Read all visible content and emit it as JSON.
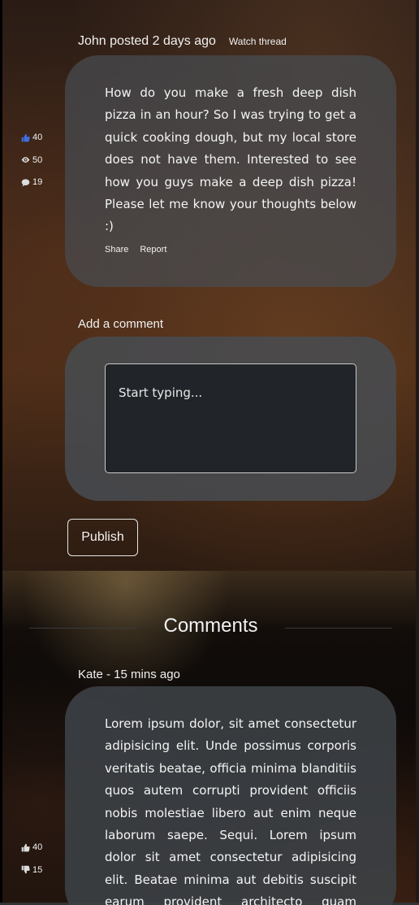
{
  "post": {
    "author_line": "John posted 2 days ago",
    "watch_label": "Watch thread",
    "body": "How do you make a fresh deep dish pizza in an hour? So I was trying to get a quick cooking dough, but my local store does not have them. Interested to see how you guys make a deep dish pizza! Please let me know your thoughts below :)",
    "share_label": "Share",
    "report_label": "Report",
    "stats": {
      "likes": "40",
      "views": "50",
      "comments": "19"
    }
  },
  "compose": {
    "label": "Add a comment",
    "placeholder": "Start typing...",
    "publish_label": "Publish"
  },
  "comments_section": {
    "title": "Comments",
    "items": [
      {
        "meta": "Kate - 15 mins ago",
        "body": "Lorem ipsum dolor, sit amet consectetur adipisicing elit. Unde possimus corporis veritatis beatae, officia minima blanditiis quos autem corrupti provident officiis nobis molestiae libero aut enim neque laborum saepe. Sequi. Lorem ipsum dolor sit amet consectetur adipisicing elit. Beatae minima aut debitis suscipit earum provident architecto quam adipisci",
        "likes": "40",
        "dislikes": "15"
      }
    ]
  },
  "colors": {
    "like_accent": "#3d6fe0",
    "card_bg": "#484c52",
    "input_bg": "#212529"
  }
}
